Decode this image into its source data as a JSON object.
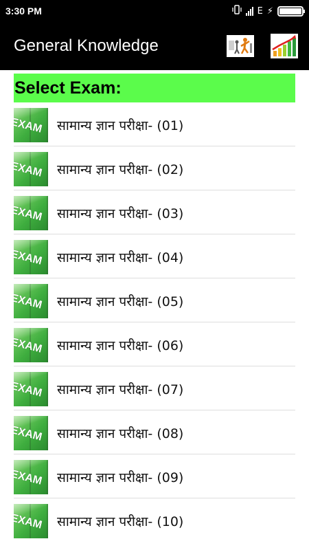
{
  "status_bar": {
    "time": "3:30 PM",
    "network_type": "E",
    "charging_symbol": "⚡"
  },
  "app_bar": {
    "title": "General Knowledge",
    "icons": [
      "exercise-figure-icon",
      "growth-chart-icon"
    ]
  },
  "section": {
    "title": "Select Exam:",
    "header_color": "#5bfc4b"
  },
  "exams": [
    {
      "label": "सामान्य ज्ञान परीक्षा- (01)",
      "thumb_text": "EXAM"
    },
    {
      "label": "सामान्य ज्ञान परीक्षा- (02)",
      "thumb_text": "EXAM"
    },
    {
      "label": "सामान्य ज्ञान परीक्षा- (03)",
      "thumb_text": "EXAM"
    },
    {
      "label": "सामान्य ज्ञान परीक्षा- (04)",
      "thumb_text": "EXAM"
    },
    {
      "label": "सामान्य ज्ञान परीक्षा- (05)",
      "thumb_text": "EXAM"
    },
    {
      "label": "सामान्य ज्ञान परीक्षा- (06)",
      "thumb_text": "EXAM"
    },
    {
      "label": "सामान्य ज्ञान परीक्षा- (07)",
      "thumb_text": "EXAM"
    },
    {
      "label": "सामान्य ज्ञान परीक्षा- (08)",
      "thumb_text": "EXAM"
    },
    {
      "label": "सामान्य ज्ञान परीक्षा- (09)",
      "thumb_text": "EXAM"
    },
    {
      "label": "सामान्य ज्ञान परीक्षा- (10)",
      "thumb_text": "EXAM"
    }
  ]
}
